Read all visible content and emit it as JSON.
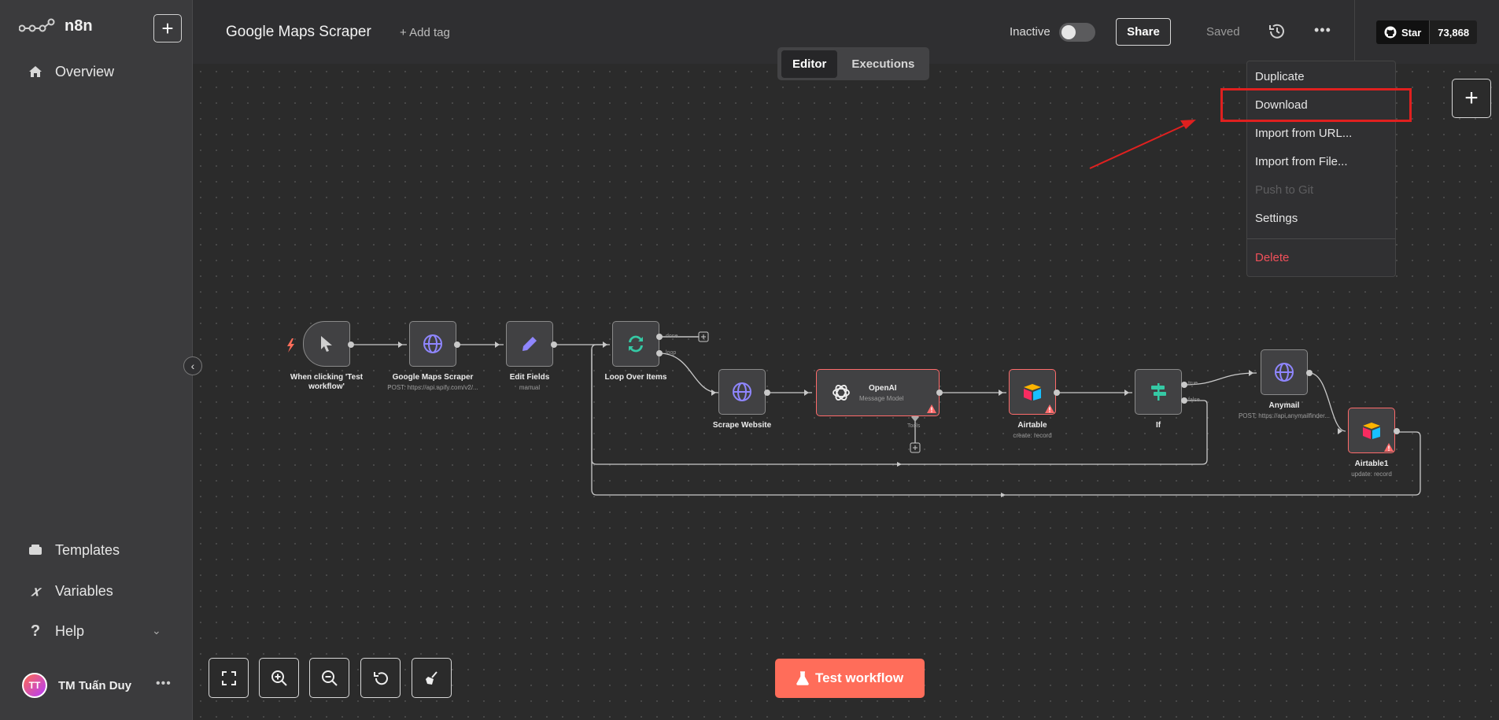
{
  "app": {
    "name": "n8n"
  },
  "sidebar": {
    "overview": "Overview",
    "templates": "Templates",
    "variables": "Variables",
    "help": "Help",
    "user_initials": "TT",
    "user_name": "TM Tuấn Duy",
    "more": "•••"
  },
  "header": {
    "workflow_title": "Google Maps Scraper",
    "add_tag": "+ Add tag",
    "status_label": "Inactive",
    "active": false,
    "share": "Share",
    "saved": "Saved",
    "more": "•••",
    "github_star": "Star",
    "github_count": "73,868"
  },
  "tabs": [
    {
      "label": "Editor",
      "active": true
    },
    {
      "label": "Executions",
      "active": false
    }
  ],
  "menu": {
    "items": [
      "Duplicate",
      "Download",
      "Import from URL...",
      "Import from File...",
      "Push to Git",
      "Settings",
      "Delete"
    ],
    "highlighted": "Download",
    "disabled": "Push to Git"
  },
  "nodes": {
    "trigger": {
      "label": "When clicking 'Test workflow'"
    },
    "gmaps": {
      "label": "Google Maps Scraper",
      "sub": "POST: https://api.apify.com/v2/..."
    },
    "edit": {
      "label": "Edit Fields",
      "sub": "manual"
    },
    "loop": {
      "label": "Loop Over Items",
      "out_done": "done",
      "out_loop": "loop"
    },
    "scrape": {
      "label": "Scrape Website"
    },
    "openai": {
      "label": "OpenAI",
      "sub": "Message Model",
      "tools": "Tools"
    },
    "airtable": {
      "label": "Airtable",
      "sub": "create: record"
    },
    "if": {
      "label": "If",
      "out_true": "true",
      "out_false": "false"
    },
    "anymail": {
      "label": "Anymail",
      "sub": "POST: https://api.anymailfinder..."
    },
    "airtable1": {
      "label": "Airtable1",
      "sub": "update: record"
    }
  },
  "controls": {
    "test_workflow": "Test workflow"
  },
  "colors": {
    "accent": "#ff6d5a",
    "error": "#ff6b6b",
    "highlight": "#e0201f"
  }
}
